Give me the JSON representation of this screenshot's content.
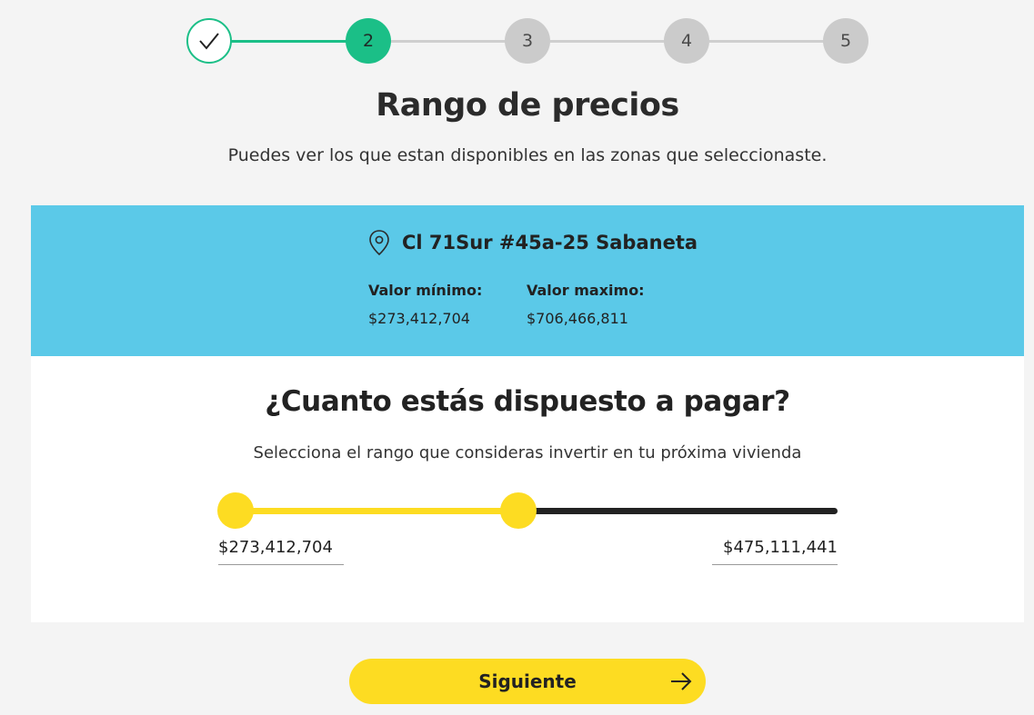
{
  "stepper": {
    "steps": [
      {
        "label": "",
        "state": "completed",
        "icon": "check-icon"
      },
      {
        "label": "2",
        "state": "active"
      },
      {
        "label": "3",
        "state": "pending"
      },
      {
        "label": "4",
        "state": "pending"
      },
      {
        "label": "5",
        "state": "pending"
      }
    ]
  },
  "header": {
    "title": "Rango de precios",
    "subtitle": "Puedes ver los que estan disponibles en las zonas que seleccionaste."
  },
  "info": {
    "icon": "location-pin-icon",
    "address": "Cl 71Sur #45a-25 Sabaneta",
    "min_label": "Valor mínimo:",
    "min_value": "$273,412,704",
    "max_label": "Valor maximo:",
    "max_value": "$706,466,811"
  },
  "slider": {
    "question": "¿Cuanto estás dispuesto a pagar?",
    "hint": "Selecciona el rango que consideras invertir en tu próxima vivienda",
    "low_value": "$273,412,704",
    "high_value": "$475,111,441",
    "selected_fraction_start": 0.0,
    "selected_fraction_end": 0.47
  },
  "footer": {
    "next_label": "Siguiente",
    "next_icon": "arrow-right-icon"
  },
  "colors": {
    "accent_green": "#1bbf87",
    "accent_yellow": "#fddc22",
    "info_blue": "#5bc9e8"
  }
}
